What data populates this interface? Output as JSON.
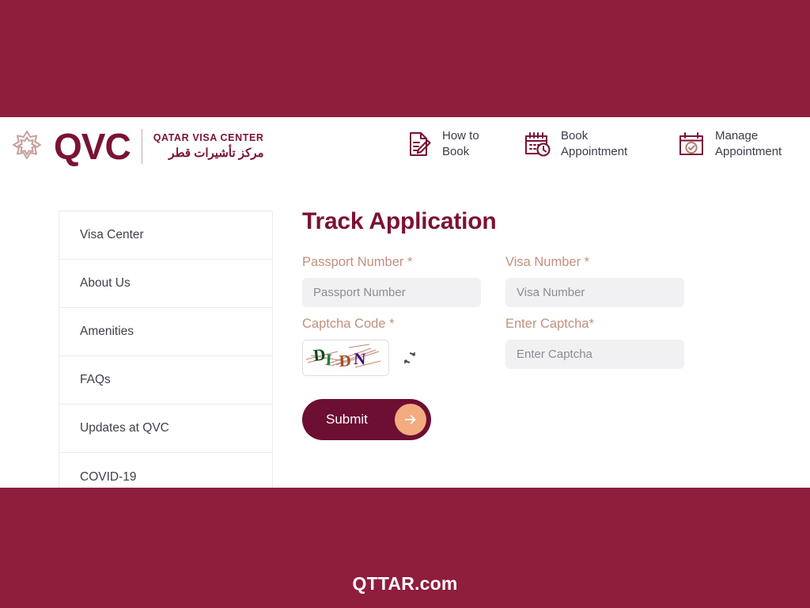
{
  "theme": {
    "banner_color": "#8f1d3c",
    "brand_maroon": "#7b1236",
    "label_tan": "#c2907e",
    "button_maroon": "#6d0f32",
    "arrow_peach": "#f3ab80",
    "input_bg": "#f1f1f3"
  },
  "header": {
    "logo_text": "QVC",
    "logo_icon": "qatar-rosette-icon",
    "tagline_en": "QATAR VISA CENTER",
    "tagline_ar": "مركز تأشيرات قطر",
    "nav": [
      {
        "label": "How to\nBook",
        "icon": "document-pencil-icon"
      },
      {
        "label": "Book\nAppointment",
        "icon": "calendar-clock-icon"
      },
      {
        "label": "Manage\nAppointment",
        "icon": "calendar-check-icon"
      }
    ]
  },
  "sidebar": {
    "items": [
      {
        "label": "Visa Center"
      },
      {
        "label": "About Us"
      },
      {
        "label": "Amenities"
      },
      {
        "label": "FAQs"
      },
      {
        "label": "Updates at QVC"
      },
      {
        "label": "COVID-19"
      }
    ]
  },
  "main": {
    "title": "Track Application",
    "fields": {
      "passport": {
        "label": "Passport Number *",
        "placeholder": "Passport Number",
        "value": ""
      },
      "visa": {
        "label": "Visa Number *",
        "placeholder": "Visa Number",
        "value": ""
      },
      "captcha_code": {
        "label": "Captcha Code *",
        "image_text": "DIDN",
        "refresh_icon": "refresh-icon"
      },
      "captcha_entry": {
        "label": "Enter Captcha*",
        "placeholder": "Enter Captcha",
        "value": ""
      }
    },
    "submit": {
      "label": "Submit",
      "arrow_icon": "arrow-right-icon"
    }
  },
  "footer": {
    "brand": "QTTAR.com"
  }
}
